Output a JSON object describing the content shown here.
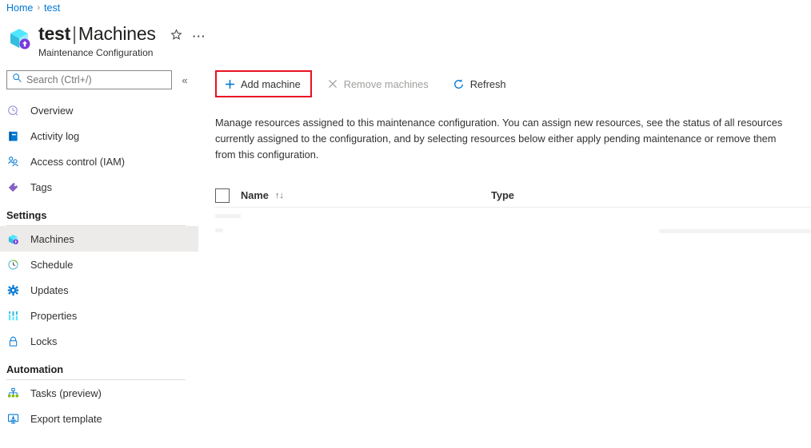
{
  "breadcrumb": {
    "home": "Home",
    "separator": "›",
    "current": "test"
  },
  "header": {
    "title_resource": "test",
    "title_divider": "|",
    "title_page": "Machines",
    "subtitle": "Maintenance Configuration",
    "favorite_icon": "star-icon",
    "more_icon": "ellipsis-icon",
    "resource_icon": "maintenance-configuration-icon"
  },
  "search": {
    "placeholder": "Search (Ctrl+/)",
    "icon": "search-icon",
    "collapse_icon": "double-chevron-left-icon",
    "collapse_glyph": "«",
    "value": ""
  },
  "sidebar": {
    "items": [
      {
        "label": "Overview",
        "icon": "overview-clock-icon",
        "selected": false
      },
      {
        "label": "Activity log",
        "icon": "activity-log-book-icon",
        "selected": false
      },
      {
        "label": "Access control (IAM)",
        "icon": "access-control-people-icon",
        "selected": false
      },
      {
        "label": "Tags",
        "icon": "tags-icon",
        "selected": false
      }
    ],
    "groups": [
      {
        "title": "Settings",
        "items": [
          {
            "label": "Machines",
            "icon": "machines-cube-icon",
            "selected": true
          },
          {
            "label": "Schedule",
            "icon": "schedule-clock-icon",
            "selected": false
          },
          {
            "label": "Updates",
            "icon": "updates-gear-icon",
            "selected": false
          },
          {
            "label": "Properties",
            "icon": "properties-bars-icon",
            "selected": false
          },
          {
            "label": "Locks",
            "icon": "locks-padlock-icon",
            "selected": false
          }
        ]
      },
      {
        "title": "Automation",
        "items": [
          {
            "label": "Tasks (preview)",
            "icon": "tasks-hierarchy-icon",
            "selected": false
          },
          {
            "label": "Export template",
            "icon": "export-template-icon",
            "selected": false
          }
        ]
      }
    ]
  },
  "toolbar": {
    "add_machine": {
      "label": "Add machine",
      "icon": "plus-icon",
      "disabled": false,
      "highlighted": true
    },
    "remove_machines": {
      "label": "Remove machines",
      "icon": "close-x-icon",
      "disabled": true,
      "highlighted": false
    },
    "refresh": {
      "label": "Refresh",
      "icon": "refresh-icon",
      "disabled": false,
      "highlighted": false
    },
    "highlight_color": "#e81123"
  },
  "main": {
    "description": "Manage resources assigned to this maintenance configuration. You can assign new resources, see the status of all resources currently assigned to the configuration, and by selecting resources below either apply pending maintenance or remove them from this configuration."
  },
  "table": {
    "select_all_checkbox": "select-all-checkbox",
    "columns": [
      {
        "label": "Name",
        "sortable": true,
        "sort_glyph": "↑↓"
      },
      {
        "label": "Type",
        "sortable": false,
        "sort_glyph": ""
      }
    ],
    "rows": []
  },
  "colors": {
    "accent": "#0078d4",
    "highlight": "#e81123",
    "selected_nav_bg": "#edebe9",
    "text": "#323130",
    "disabled_text": "#a19f9d"
  }
}
